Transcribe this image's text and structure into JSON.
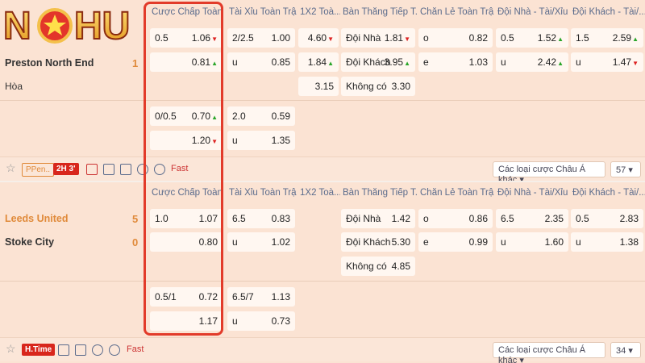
{
  "logo": {
    "text": "NOHU"
  },
  "headers": [
    "Cược Chấp Toàn ...",
    "Tài Xỉu Toàn Trận",
    "1X2 Toà...",
    "Bàn Thắng Tiếp T...",
    "Chẵn Lẻ Toàn Trận",
    "Đội Nhà - Tài/Xỉu",
    "Đội Khách - Tài/..."
  ],
  "match1": {
    "home": "Preston North End",
    "home_score": "1",
    "draw": "Hòa",
    "ah": [
      {
        "l": "0.5",
        "r": "1.06",
        "t": "dn"
      },
      {
        "l": "",
        "r": "0.81",
        "t": "up"
      },
      {
        "l": "0/0.5",
        "r": "0.70",
        "t": "up"
      },
      {
        "l": "",
        "r": "1.20",
        "t": "dn"
      }
    ],
    "ou": [
      {
        "l": "2/2.5",
        "r": "1.00"
      },
      {
        "l": "u",
        "r": "0.85"
      },
      {
        "l": "2.0",
        "r": "0.59"
      },
      {
        "l": "u",
        "r": "1.35"
      }
    ],
    "x12": [
      {
        "r": "4.60",
        "t": "dn"
      },
      {
        "r": "1.84",
        "t": "up"
      },
      {
        "r": "3.15"
      }
    ],
    "next": [
      {
        "l": "Đội Nhà",
        "r": "1.81",
        "t": "dn"
      },
      {
        "l": "Đội Khách",
        "r": "3.95",
        "t": "up"
      },
      {
        "l": "Không có",
        "r": "3.30"
      }
    ],
    "oe": [
      {
        "l": "o",
        "r": "0.82"
      },
      {
        "l": "e",
        "r": "1.03"
      }
    ],
    "hou": [
      {
        "l": "0.5",
        "r": "1.52",
        "t": "up"
      },
      {
        "l": "u",
        "r": "2.42",
        "t": "up"
      }
    ],
    "aou": [
      {
        "l": "1.5",
        "r": "2.59",
        "t": "up"
      },
      {
        "l": "u",
        "r": "1.47",
        "t": "dn"
      }
    ],
    "bar": {
      "tag1": "PPen..",
      "tag2": "2H 3'",
      "fast": "Fast",
      "select": "Các loại cược Châu Á khác",
      "count": "57"
    }
  },
  "match2": {
    "home": "Leeds United",
    "home_score": "5",
    "away": "Stoke City",
    "away_score": "0",
    "ah": [
      {
        "l": "1.0",
        "r": "1.07"
      },
      {
        "l": "",
        "r": "0.80"
      },
      {
        "l": "0.5/1",
        "r": "0.72"
      },
      {
        "l": "",
        "r": "1.17"
      }
    ],
    "ou": [
      {
        "l": "6.5",
        "r": "0.83"
      },
      {
        "l": "u",
        "r": "1.02"
      },
      {
        "l": "6.5/7",
        "r": "1.13"
      },
      {
        "l": "u",
        "r": "0.73"
      }
    ],
    "next": [
      {
        "l": "Đội Nhà",
        "r": "1.42"
      },
      {
        "l": "Đội Khách",
        "r": "5.30"
      },
      {
        "l": "Không có",
        "r": "4.85"
      }
    ],
    "oe": [
      {
        "l": "o",
        "r": "0.86"
      },
      {
        "l": "e",
        "r": "0.99"
      }
    ],
    "hou": [
      {
        "l": "6.5",
        "r": "2.35"
      },
      {
        "l": "u",
        "r": "1.60"
      }
    ],
    "aou": [
      {
        "l": "0.5",
        "r": "2.83"
      },
      {
        "l": "u",
        "r": "1.38"
      }
    ],
    "bar": {
      "tag1": "H.Time",
      "fast": "Fast",
      "select": "Các loại cược Châu Á khác",
      "count": "34"
    }
  },
  "colors": {
    "highlight": "#e23b2a",
    "up": "#2aa62a",
    "down": "#dd2222",
    "score": "#e08a3a",
    "bg": "#fbe3d3"
  }
}
